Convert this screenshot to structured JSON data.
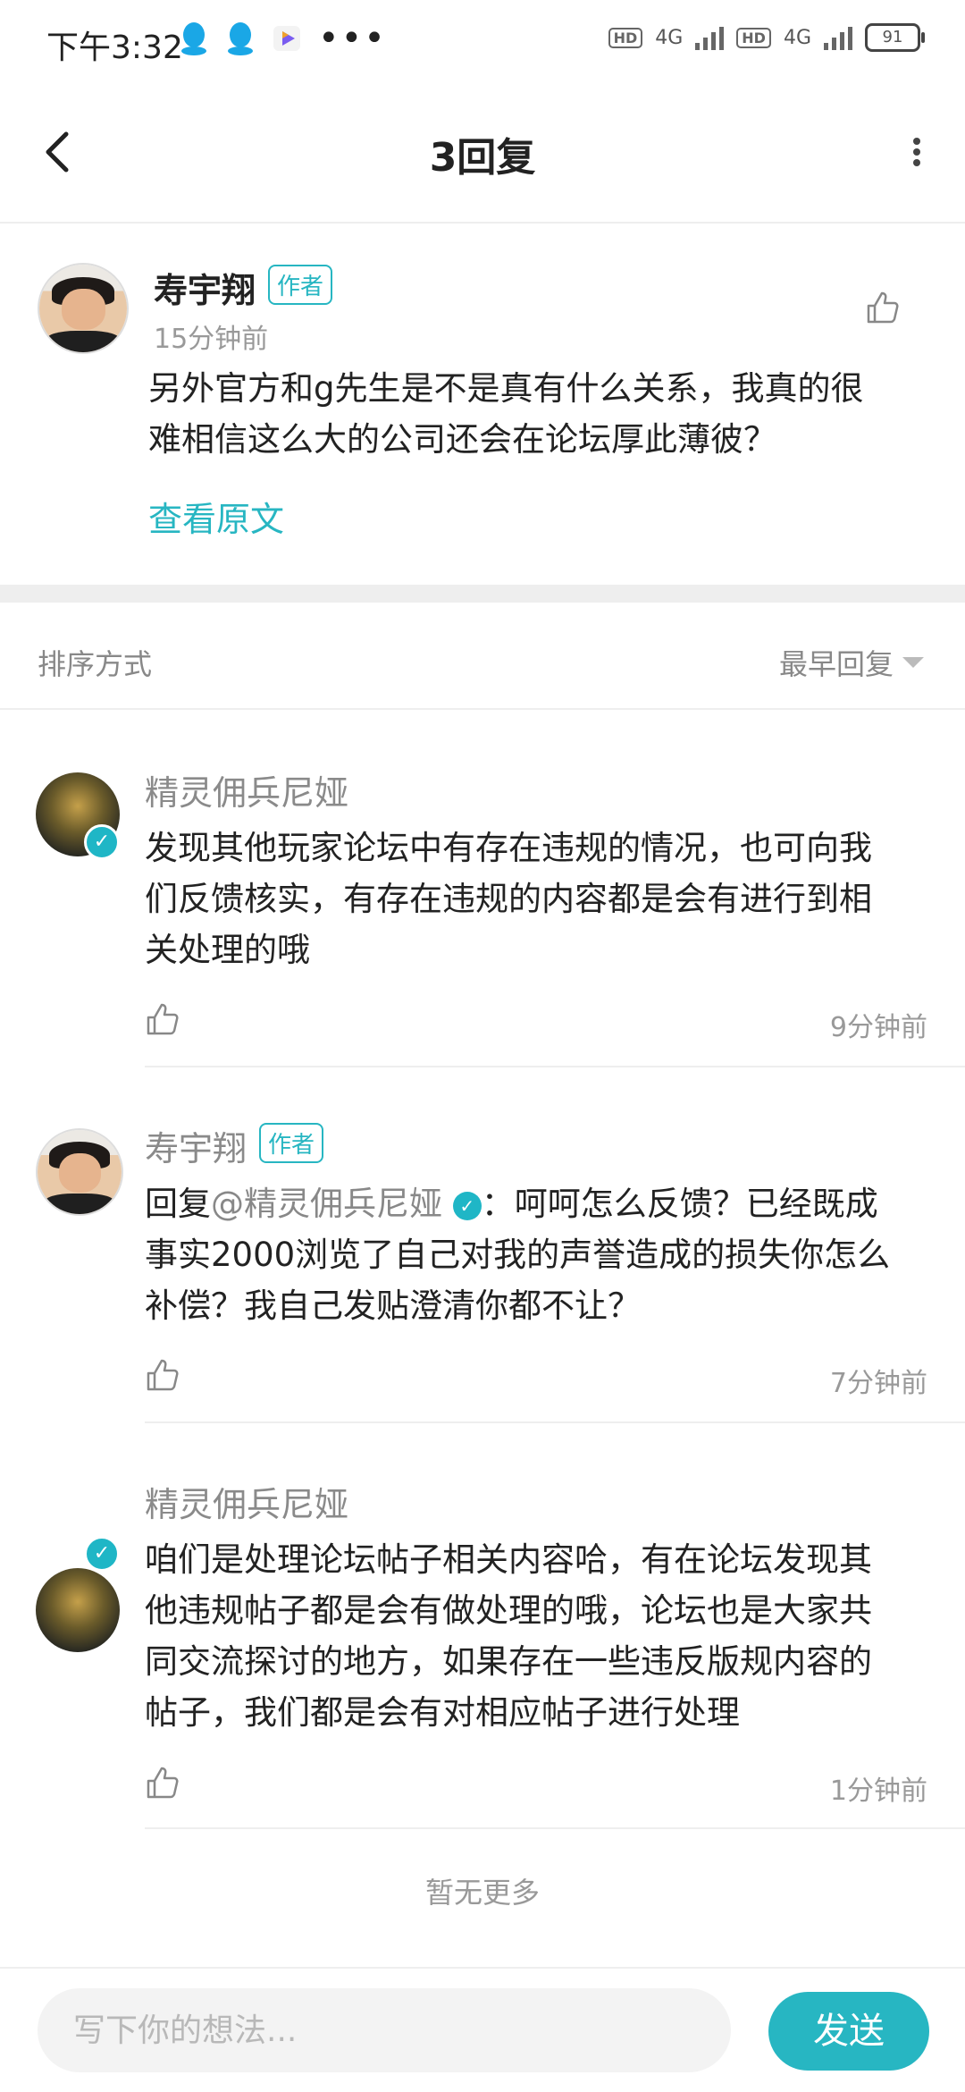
{
  "status": {
    "time": "下午3:32",
    "network1": "4G",
    "network2": "4G",
    "battery": "91"
  },
  "nav": {
    "title": "3回复"
  },
  "post": {
    "author": "寿宇翔",
    "author_tag": "作者",
    "time": "15分钟前",
    "text_line1": "另外官方和g先生是不是真有什么关系，我真的很",
    "text_line2": "难相信这么大的公司还会在论坛厚此薄彼？",
    "view_original": "查看原文"
  },
  "sort": {
    "label": "排序方式",
    "value": "最早回复"
  },
  "replies": [
    {
      "name": "精灵佣兵尼娅",
      "lines": [
        "发现其他玩家论坛中有存在违规的情况，也可向我",
        "们反馈核实，有存在违规的内容都是会有进行到相",
        "关处理的哦"
      ],
      "time": "9分钟前"
    },
    {
      "name": "寿宇翔",
      "tag": "作者",
      "reply_prefix": "回复",
      "mention": "@精灵佣兵尼娅",
      "line1_rest": "：呵呵怎么反馈？已经既成",
      "lines": [
        "事实2000浏览了自己对我的声誉造成的损失你怎么",
        "补偿？我自己发贴澄清你都不让？"
      ],
      "time": "7分钟前"
    },
    {
      "name": "精灵佣兵尼娅",
      "lines": [
        "咱们是处理论坛帖子相关内容哈，有在论坛发现其",
        "他违规帖子都是会有做处理的哦，论坛也是大家共",
        "同交流探讨的地方，如果存在一些违反版规内容的",
        "帖子，我们都是会有对相应帖子进行处理"
      ],
      "time": "1分钟前"
    }
  ],
  "footer": {
    "no_more": "暂无更多"
  },
  "composer": {
    "placeholder": "写下你的想法...",
    "send": "发送"
  },
  "colors": {
    "accent": "#27b6c2"
  }
}
